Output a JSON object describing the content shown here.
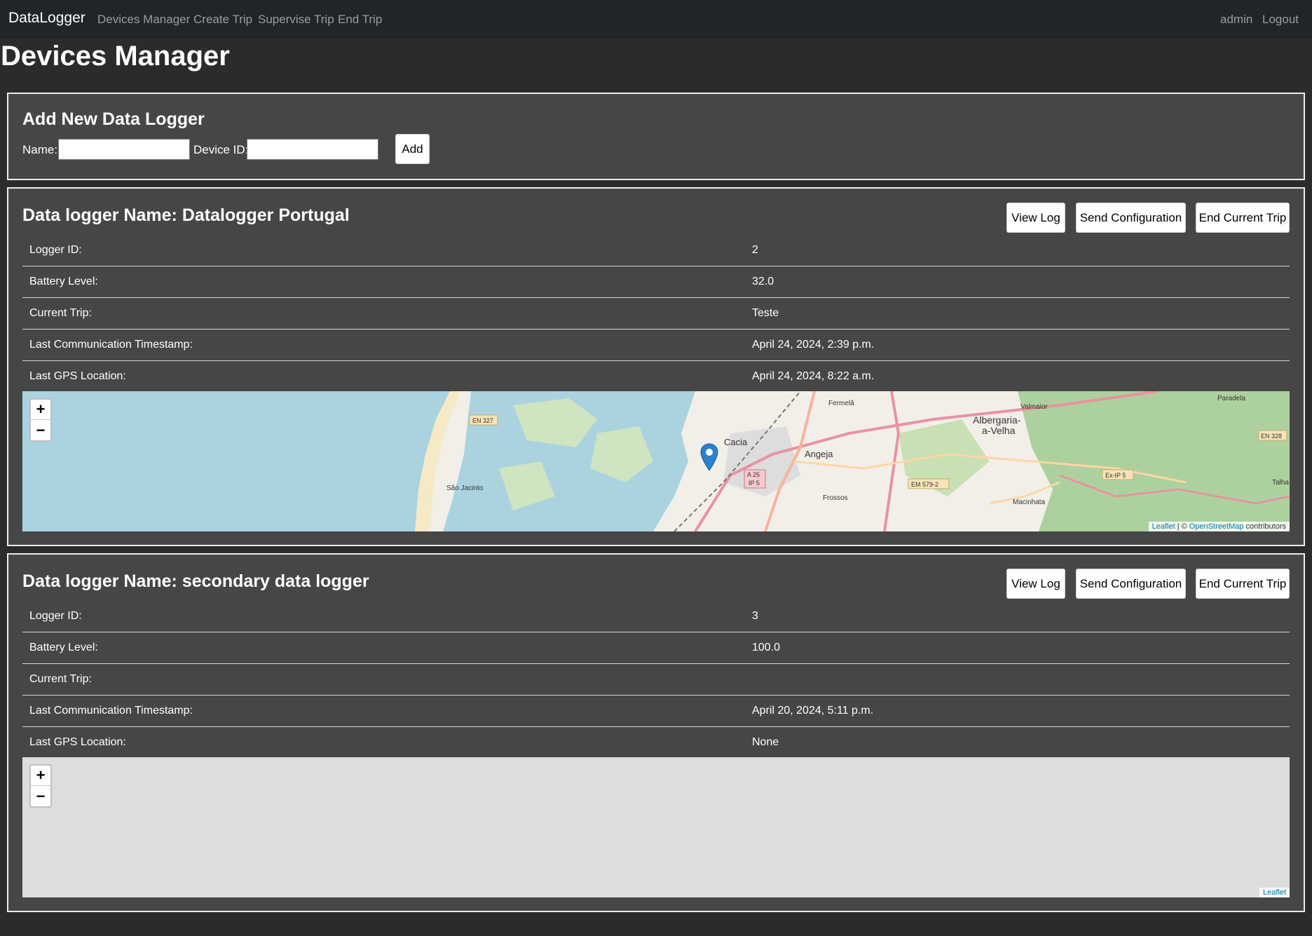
{
  "navbar": {
    "brand": "DataLogger",
    "links": [
      "Devices Manager",
      "Create Trip",
      "Supervise Trip",
      "End Trip"
    ],
    "user": "admin",
    "logout": "Logout"
  },
  "page_title": "Devices Manager",
  "add_form": {
    "title": "Add New Data Logger",
    "name_label": "Name:",
    "name_value": "",
    "device_id_label": "Device ID:",
    "device_id_value": "",
    "add_button": "Add"
  },
  "loggers": [
    {
      "title": "Data logger Name: Datalogger Portugal",
      "buttons": {
        "view_log": "View Log",
        "send_config": "Send Configuration",
        "end_trip": "End Current Trip"
      },
      "rows": [
        {
          "label": "Logger ID:",
          "value": "2"
        },
        {
          "label": "Battery Level:",
          "value": "32.0"
        },
        {
          "label": "Current Trip:",
          "value": "Teste"
        },
        {
          "label": "Last Communication Timestamp:",
          "value": "April 24, 2024, 2:39 p.m."
        },
        {
          "label": "Last GPS Location:",
          "value": "April 24, 2024, 8:22 a.m."
        }
      ],
      "map": {
        "zoom_in": "+",
        "zoom_out": "−",
        "attribution_leaflet": "Leaflet",
        "attribution_sep": " | © ",
        "attribution_osm": "OpenStreetMap",
        "attribution_tail": " contributors",
        "places": [
          "Fermelã",
          "Valmaior",
          "Paradela",
          "EN 327",
          "Albergaria-",
          "a-Velha",
          "EN 328",
          "Cacia",
          "Angeja",
          "A 25",
          "IP 5",
          "Ex-IP 5",
          "EM 579-2",
          "São Jacinto",
          "Frossos",
          "Macinhata",
          "Talha"
        ],
        "colors": {
          "water": "#aad3df",
          "land": "#f2efe9",
          "forest": "#add19e",
          "road": "#e892a2",
          "marker": "#2a81cb"
        }
      }
    },
    {
      "title": "Data logger Name: secondary data logger",
      "buttons": {
        "view_log": "View Log",
        "send_config": "Send Configuration",
        "end_trip": "End Current Trip"
      },
      "rows": [
        {
          "label": "Logger ID:",
          "value": "3"
        },
        {
          "label": "Battery Level:",
          "value": "100.0"
        },
        {
          "label": "Current Trip:",
          "value": ""
        },
        {
          "label": "Last Communication Timestamp:",
          "value": "April 20, 2024, 5:11 p.m."
        },
        {
          "label": "Last GPS Location:",
          "value": "None"
        }
      ],
      "map": {
        "zoom_in": "+",
        "zoom_out": "−",
        "attribution_leaflet": "Leaflet"
      }
    }
  ]
}
